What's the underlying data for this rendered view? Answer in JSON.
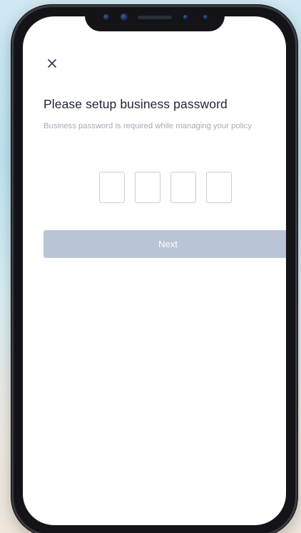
{
  "header": {
    "close_icon": "close-icon"
  },
  "main": {
    "title": "Please setup business password",
    "subtitle": "Business password is required while managing your policy",
    "code_boxes": [
      "",
      "",
      "",
      ""
    ],
    "next_label": "Next"
  },
  "colors": {
    "title": "#1e2433",
    "subtitle": "#a7abb5",
    "button_disabled": "#b9c4d6",
    "box_border": "#c9ccd3"
  }
}
